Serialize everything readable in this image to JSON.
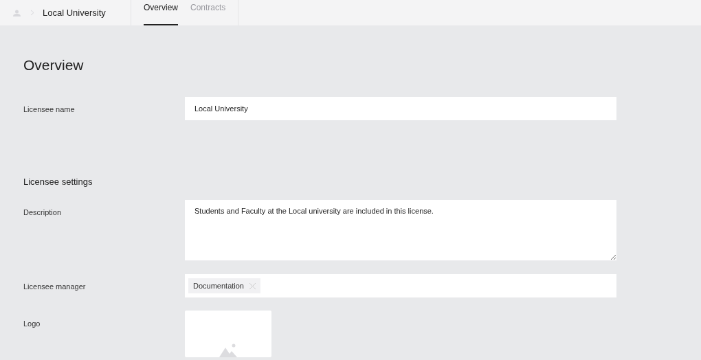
{
  "breadcrumb": {
    "title": "Local University"
  },
  "tabs": [
    {
      "label": "Overview",
      "selected": true
    },
    {
      "label": "Contracts",
      "selected": false
    }
  ],
  "page_title": "Overview",
  "licensee_name": {
    "label": "Licensee name",
    "value": "Local University"
  },
  "settings": {
    "heading": "Licensee settings",
    "description": {
      "label": "Description",
      "value": "Students and Faculty at the Local university are included in this license."
    },
    "manager": {
      "label": "Licensee manager",
      "tags": [
        "Documentation"
      ]
    },
    "logo": {
      "label": "Logo"
    }
  }
}
